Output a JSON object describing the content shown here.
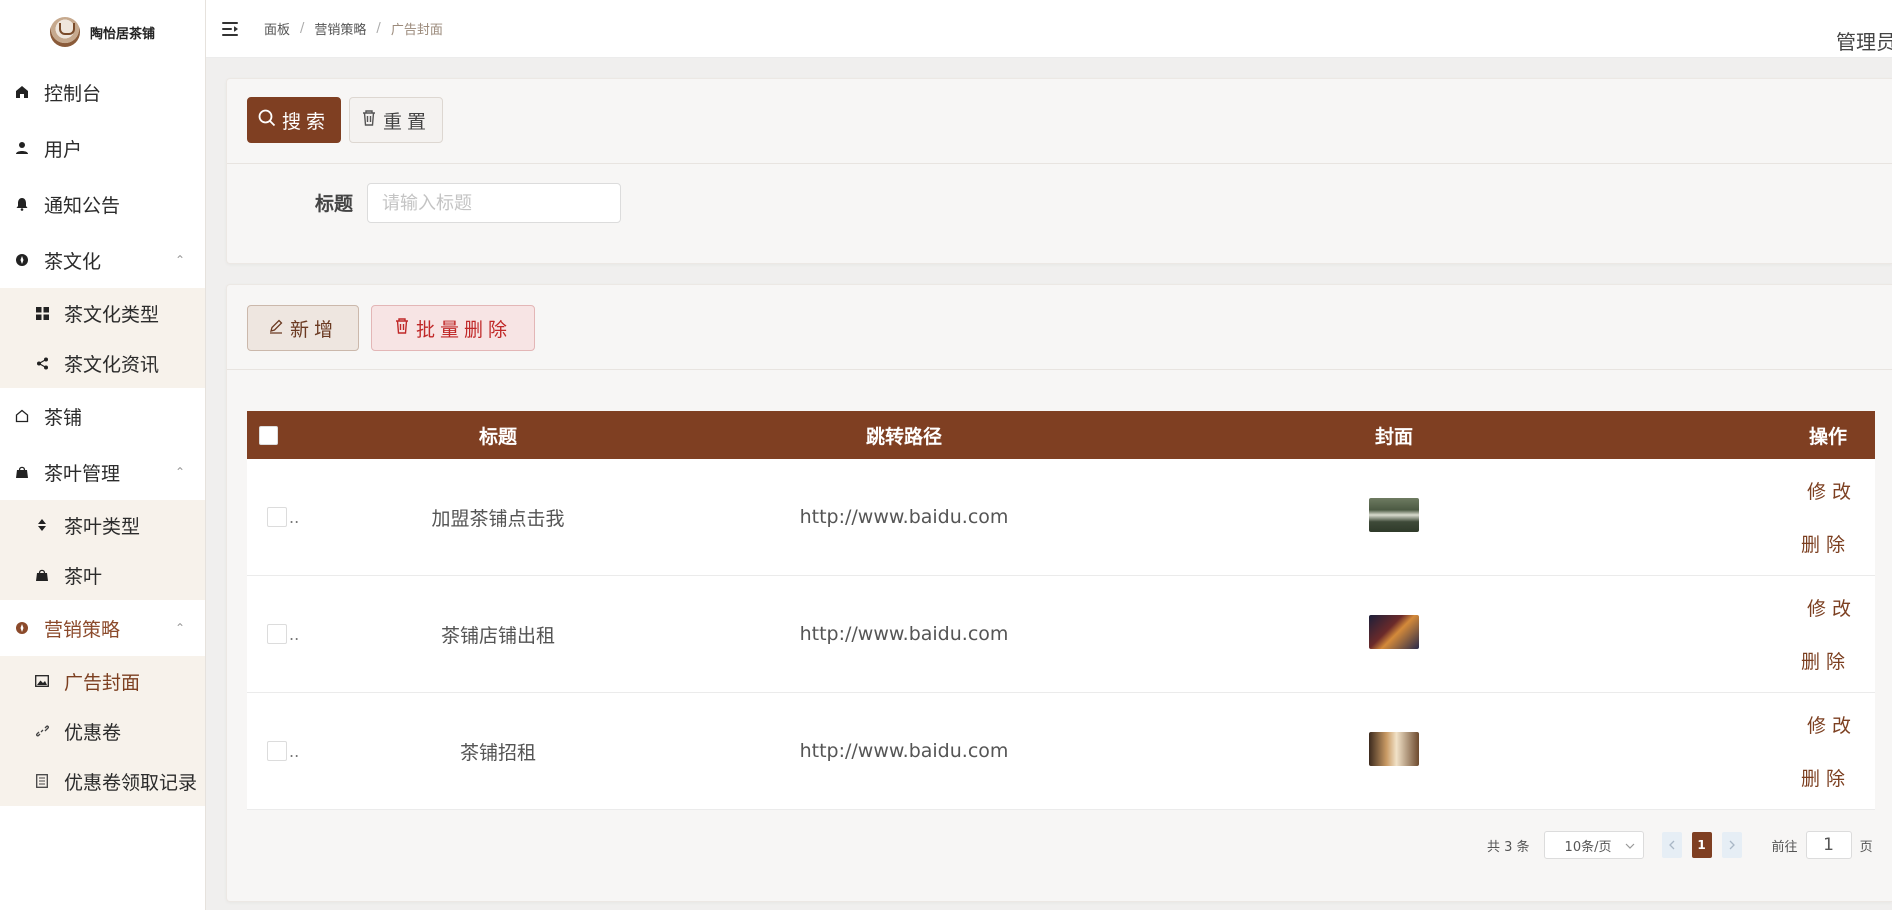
{
  "brand": {
    "name": "陶怡居茶铺"
  },
  "sidebar": {
    "items": [
      {
        "label": "控制台",
        "icon": "home-icon"
      },
      {
        "label": "用户",
        "icon": "user-icon"
      },
      {
        "label": "通知公告",
        "icon": "bell-icon"
      },
      {
        "label": "茶文化",
        "icon": "compass-icon"
      },
      {
        "label": "茶文化类型",
        "icon": "grid-icon"
      },
      {
        "label": "茶文化资讯",
        "icon": "share-icon"
      },
      {
        "label": "茶铺",
        "icon": "house-outline-icon"
      },
      {
        "label": "茶叶管理",
        "icon": "bag-icon"
      },
      {
        "label": "茶叶类型",
        "icon": "sort-icon"
      },
      {
        "label": "茶叶",
        "icon": "bag-icon"
      },
      {
        "label": "营销策略",
        "icon": "compass-icon"
      },
      {
        "label": "广告封面",
        "icon": "image-icon"
      },
      {
        "label": "优惠卷",
        "icon": "link-icon"
      },
      {
        "label": "优惠卷领取记录",
        "icon": "document-icon"
      }
    ]
  },
  "topbar": {
    "breadcrumb": [
      "面板",
      "营销策略",
      "广告封面"
    ],
    "admin": "管理员"
  },
  "search": {
    "search_button": "搜索",
    "reset_button": "重置",
    "title_label": "标题",
    "title_placeholder": "请输入标题",
    "title_value": ""
  },
  "actions": {
    "add_button": "新增",
    "batch_delete_button": "批量删除"
  },
  "table": {
    "headers": {
      "title": "标题",
      "url": "跳转路径",
      "cover": "封面",
      "ops": "操作"
    },
    "rows": [
      {
        "title": "加盟茶铺点击我",
        "url": "http://www.baidu.com"
      },
      {
        "title": "茶铺店铺出租",
        "url": "http://www.baidu.com"
      },
      {
        "title": "茶铺招租",
        "url": "http://www.baidu.com"
      }
    ],
    "edit_label": "修改",
    "delete_label": "删除"
  },
  "pagination": {
    "total": "共 3 条",
    "page_size": "10条/页",
    "current_page": "1",
    "goto_prefix": "前往",
    "goto_value": "1",
    "goto_suffix": "页"
  },
  "colors": {
    "primary": "#7f3f22",
    "danger": "#c02828",
    "submenu_bg": "#f7f2eb"
  }
}
